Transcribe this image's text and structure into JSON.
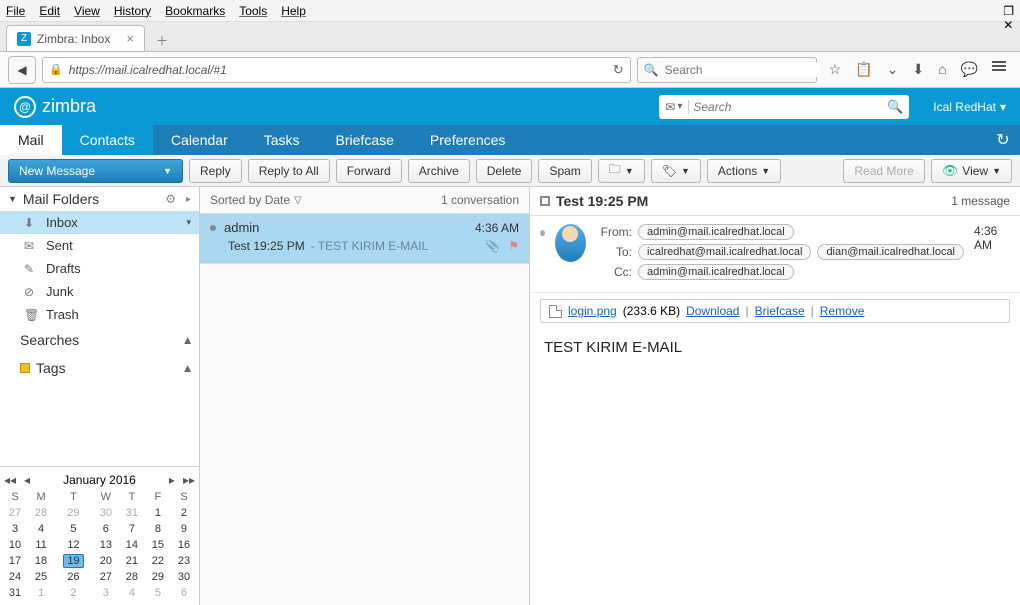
{
  "browser": {
    "menus": [
      "File",
      "Edit",
      "View",
      "History",
      "Bookmarks",
      "Tools",
      "Help"
    ],
    "tab_title": "Zimbra: Inbox",
    "url": "https://mail.icalredhat.local/#1",
    "search_placeholder": "Search"
  },
  "zimbra": {
    "brand": "zimbra",
    "search_placeholder": "Search",
    "user": "Ical RedHat",
    "nav": {
      "mail": "Mail",
      "contacts": "Contacts",
      "calendar": "Calendar",
      "tasks": "Tasks",
      "briefcase": "Briefcase",
      "preferences": "Preferences"
    },
    "toolbar": {
      "new_message": "New Message",
      "reply": "Reply",
      "reply_all": "Reply to All",
      "forward": "Forward",
      "archive": "Archive",
      "delete": "Delete",
      "spam": "Spam",
      "actions": "Actions",
      "read_more": "Read More",
      "view": "View"
    },
    "sidebar": {
      "title": "Mail Folders",
      "folders": [
        {
          "name": "Inbox",
          "icon": "inbox"
        },
        {
          "name": "Sent",
          "icon": "sent"
        },
        {
          "name": "Drafts",
          "icon": "drafts"
        },
        {
          "name": "Junk",
          "icon": "junk"
        },
        {
          "name": "Trash",
          "icon": "trash"
        }
      ],
      "searches": "Searches",
      "tags": "Tags"
    },
    "calendar": {
      "title": "January 2016",
      "dow": [
        "S",
        "M",
        "T",
        "W",
        "T",
        "F",
        "S"
      ],
      "weeks": [
        [
          "27",
          "28",
          "29",
          "30",
          "31",
          "1",
          "2"
        ],
        [
          "3",
          "4",
          "5",
          "6",
          "7",
          "8",
          "9"
        ],
        [
          "10",
          "11",
          "12",
          "13",
          "14",
          "15",
          "16"
        ],
        [
          "17",
          "18",
          "19",
          "20",
          "21",
          "22",
          "23"
        ],
        [
          "24",
          "25",
          "26",
          "27",
          "28",
          "29",
          "30"
        ],
        [
          "31",
          "1",
          "2",
          "3",
          "4",
          "5",
          "6"
        ]
      ],
      "today": "19"
    },
    "list": {
      "sort": "Sorted by Date",
      "count": "1 conversation",
      "msg": {
        "from": "admin",
        "time": "4:36 AM",
        "subject": "Test 19:25 PM",
        "preview": "TEST KIRIM E-MAIL"
      }
    },
    "reader": {
      "subject": "Test 19:25 PM",
      "count": "1 message",
      "time": "4:36 AM",
      "labels": {
        "from": "From:",
        "to": "To:",
        "cc": "Cc:"
      },
      "from": "admin@mail.icalredhat.local",
      "to": [
        "icalredhat@mail.icalredhat.local",
        "dian@mail.icalredhat.local"
      ],
      "cc": "admin@mail.icalredhat.local",
      "attachment": {
        "name": "login.png",
        "size": "(233.6 KB)",
        "download": "Download",
        "briefcase": "Briefcase",
        "remove": "Remove"
      },
      "body": "TEST KIRIM E-MAIL"
    }
  }
}
